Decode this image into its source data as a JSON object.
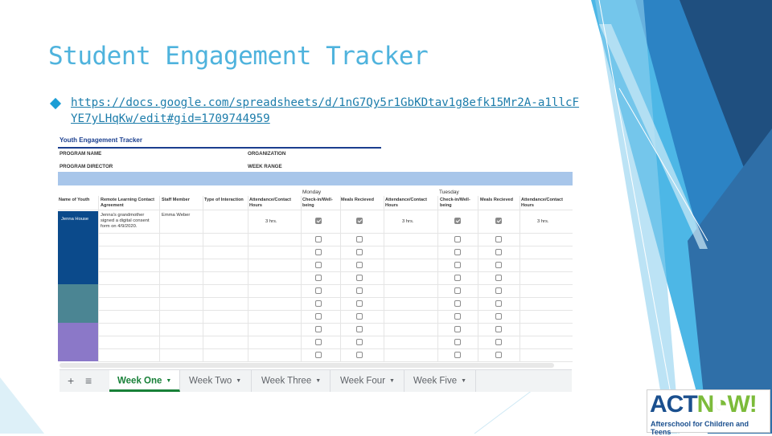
{
  "slide": {
    "title": "Student Engagement Tracker",
    "link": "https://docs.google.com/spreadsheets/d/1nG7Qy5r1GbKDtav1g8efk15Mr2A-a1llcFYE7yLHqKw/edit#gid=1709744959"
  },
  "sheet": {
    "title": "Youth Engagement Tracker",
    "program_name_label": "PROGRAM NAME",
    "organization_label": "ORGANIZATION",
    "program_director_label": "PROGRAM DIRECTOR",
    "week_range_label": "WEEK RANGE",
    "days": [
      "Monday",
      "Tuesday"
    ],
    "headers": {
      "name": "Name of Youth",
      "remote": "Remote Learning Contact Agreement",
      "staff": "Staff Member",
      "type": "Type of Interaction",
      "mon_att": "Attendance/Contact Hours",
      "mon_check": "Check-in/Well-being",
      "mon_meals": "Meals Recieved",
      "tue_att": "Attendance/Contact Hours",
      "tue_check": "Check-in/Well-being",
      "tue_meals": "Meals Recieved",
      "wed_att": "Attendance/Contact Hours"
    },
    "first_row": {
      "name": "Jenna House",
      "agreement": "Jenna's grandmother signed a digital consent form on 4/9/2020.",
      "staff": "Emma Weber",
      "mon_hours": "3 hrs.",
      "tue_hours": "3 hrs.",
      "wed_hours": "3 hrs."
    },
    "row_colors": [
      "#0b4a8b",
      "#0b4a8b",
      "#0b4a8b",
      "#0b4a8b",
      "#4b8593",
      "#4b8593",
      "#4b8593",
      "#8b78c8",
      "#8b78c8",
      "#8b78c8"
    ]
  },
  "tabs": {
    "add_icon": "+",
    "list_icon": "≡",
    "items": [
      "Week One",
      "Week Two",
      "Week Three",
      "Week Four",
      "Week Five"
    ],
    "active": "Week One"
  },
  "logo": {
    "act": "ACT",
    "now": "N",
    "now_rest": "W!",
    "subtitle": "Afterschool for Children and Teens"
  },
  "colors": {
    "accent": "#4fb3dd",
    "deco_dark": "#1f4f7f",
    "deco_mid": "#2c83c4",
    "deco_light": "#4db7e6"
  }
}
